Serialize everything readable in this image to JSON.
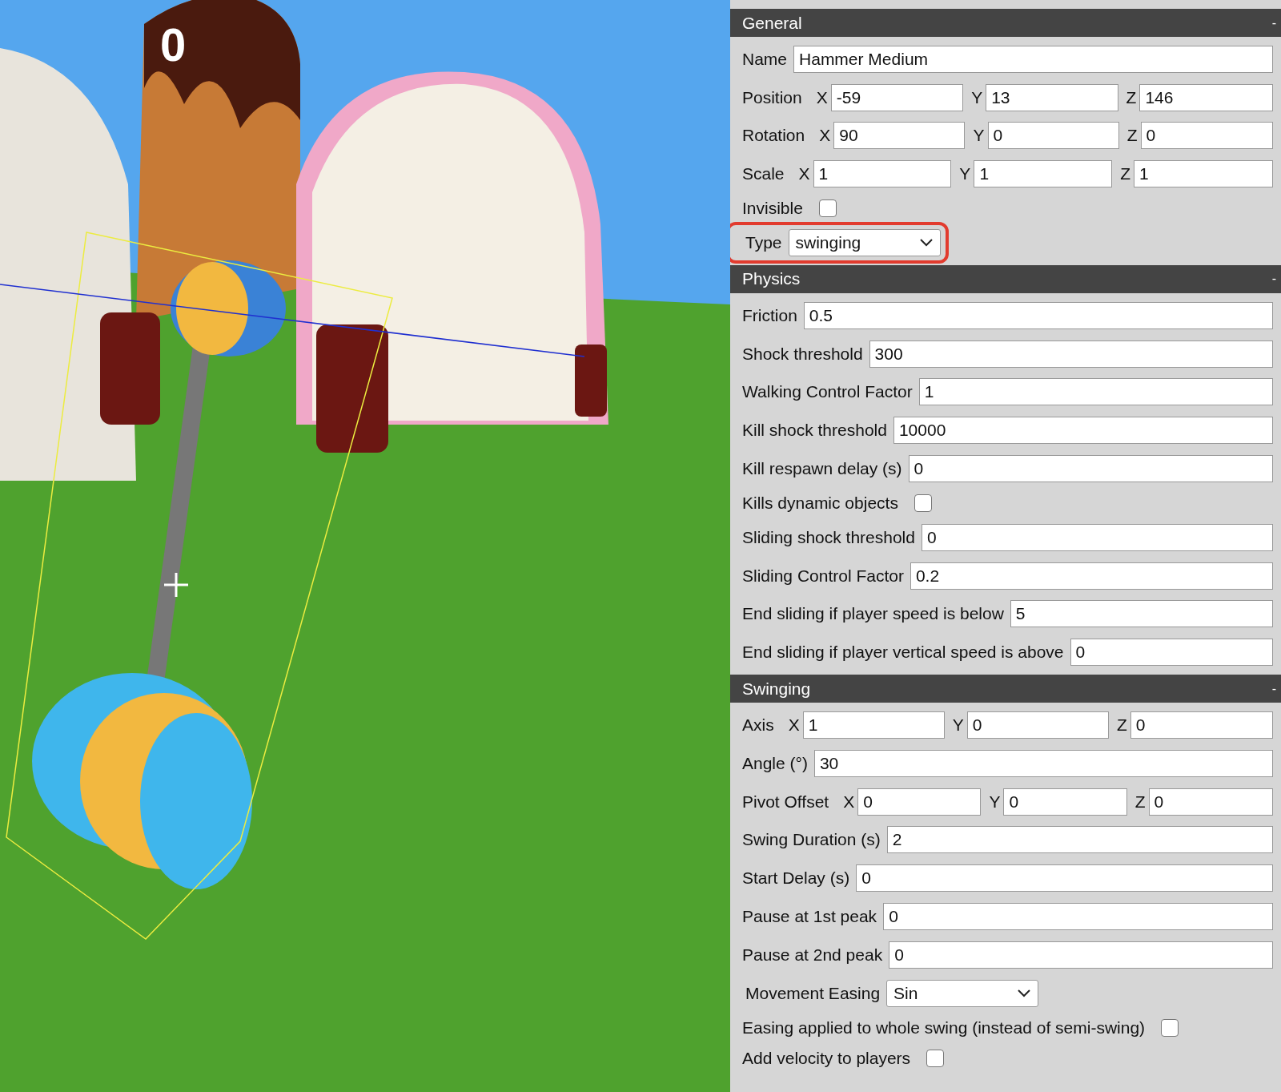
{
  "viewport": {
    "score": "0"
  },
  "sections": [
    {
      "title": "General",
      "toggle": "-",
      "rows": [
        {
          "kind": "text",
          "label": "Name",
          "value": "Hammer Medium"
        },
        {
          "kind": "xyz",
          "label": "Position",
          "axes": [
            {
              "axis": "X",
              "value": "-59"
            },
            {
              "axis": "Y",
              "value": "13"
            },
            {
              "axis": "Z",
              "value": "146"
            }
          ]
        },
        {
          "kind": "xyz",
          "label": "Rotation",
          "axes": [
            {
              "axis": "X",
              "value": "90"
            },
            {
              "axis": "Y",
              "value": "0"
            },
            {
              "axis": "Z",
              "value": "0"
            }
          ]
        },
        {
          "kind": "xyz",
          "label": "Scale",
          "axes": [
            {
              "axis": "X",
              "value": "1"
            },
            {
              "axis": "Y",
              "value": "1"
            },
            {
              "axis": "Z",
              "value": "1"
            }
          ]
        },
        {
          "kind": "checkbox",
          "label": "Invisible",
          "checked": false
        },
        {
          "kind": "select",
          "label": "Type",
          "value": "swinging",
          "highlighted": true
        }
      ]
    },
    {
      "title": "Physics",
      "toggle": "-",
      "rows": [
        {
          "kind": "text",
          "label": "Friction",
          "value": "0.5"
        },
        {
          "kind": "text",
          "label": "Shock threshold",
          "value": "300"
        },
        {
          "kind": "text",
          "label": "Walking Control Factor",
          "value": "1"
        },
        {
          "kind": "text",
          "label": "Kill shock threshold",
          "value": "10000"
        },
        {
          "kind": "text",
          "label": "Kill respawn delay (s)",
          "value": "0"
        },
        {
          "kind": "checkbox",
          "label": "Kills dynamic objects",
          "checked": false
        },
        {
          "kind": "text",
          "label": "Sliding shock threshold",
          "value": "0"
        },
        {
          "kind": "text",
          "label": "Sliding Control Factor",
          "value": "0.2"
        },
        {
          "kind": "text",
          "label": "End sliding if player speed is below",
          "value": "5"
        },
        {
          "kind": "text",
          "label": "End sliding if player vertical speed is above",
          "value": "0"
        }
      ]
    },
    {
      "title": "Swinging",
      "toggle": "-",
      "rows": [
        {
          "kind": "xyz",
          "label": "Axis",
          "axes": [
            {
              "axis": "X",
              "value": "1"
            },
            {
              "axis": "Y",
              "value": "0"
            },
            {
              "axis": "Z",
              "value": "0"
            }
          ]
        },
        {
          "kind": "text",
          "label": "Angle (°)",
          "value": "30"
        },
        {
          "kind": "xyz",
          "label": "Pivot Offset",
          "axes": [
            {
              "axis": "X",
              "value": "0"
            },
            {
              "axis": "Y",
              "value": "0"
            },
            {
              "axis": "Z",
              "value": "0"
            }
          ]
        },
        {
          "kind": "text",
          "label": "Swing Duration (s)",
          "value": "2"
        },
        {
          "kind": "text",
          "label": "Start Delay (s)",
          "value": "0"
        },
        {
          "kind": "text",
          "label": "Pause at 1st peak",
          "value": "0"
        },
        {
          "kind": "text",
          "label": "Pause at 2nd peak",
          "value": "0"
        },
        {
          "kind": "select",
          "label": "Movement Easing",
          "value": "Sin",
          "highlighted": false
        },
        {
          "kind": "checkbox",
          "label": "Easing applied to whole swing (instead of semi-swing)",
          "checked": false
        },
        {
          "kind": "checkbox",
          "label": "Add velocity to players",
          "checked": false
        }
      ]
    }
  ]
}
